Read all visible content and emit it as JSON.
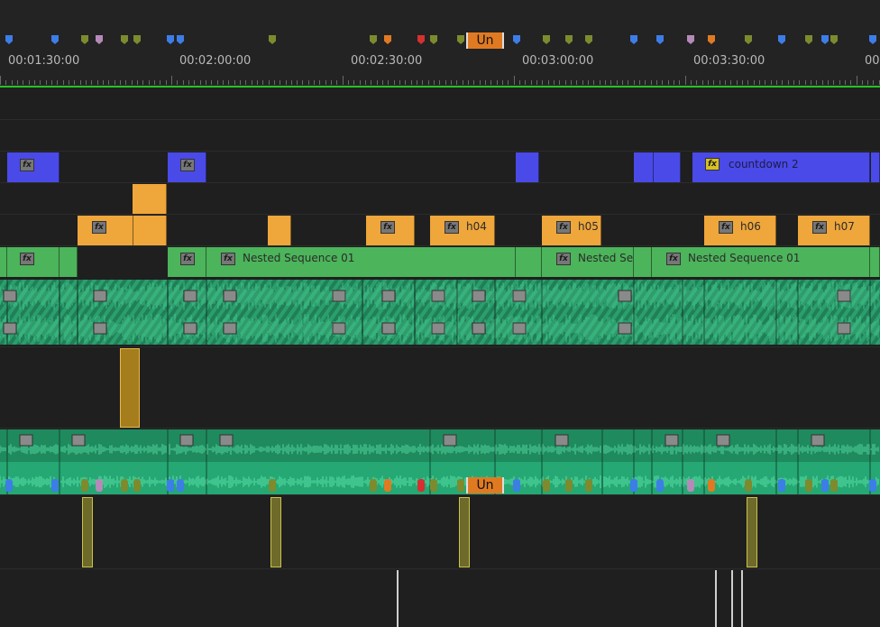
{
  "ruler": {
    "timecodes": [
      "00:01:30:00",
      "00:02:00:00",
      "00:02:30:00",
      "00:03:00:00",
      "00:03:30:00",
      "00"
    ],
    "marker_colors": {
      "blue": "#3d7de8",
      "green": "#7d8b2e",
      "pink": "#b58ab8",
      "orange": "#e07a22",
      "red": "#d63030",
      "playhead_line": "#22c422"
    },
    "markers": [
      "blue",
      "blue",
      "green",
      "pink",
      "green",
      "green",
      "blue",
      "blue",
      "green",
      "green",
      "orange",
      "red",
      "green",
      "green",
      "blue",
      "green",
      "green",
      "green",
      "blue",
      "blue",
      "pink",
      "orange",
      "green",
      "blue",
      "green",
      "blue",
      "green",
      "blue"
    ],
    "marker_label": "Un"
  },
  "tracks": {
    "v4_color": "#4a4ae8",
    "v3_color": "#efa63a",
    "v1_color": "#4cb45a",
    "audio_color": "#1fa774",
    "v4_label": "countdown 2",
    "v2_labels": [
      "h04",
      "h05",
      "h06",
      "h07"
    ],
    "v1_labels": [
      "Nested Sequence 01",
      "Nested Se",
      "Nested Sequence 01"
    ],
    "fx_label": "fx",
    "audio_marker_label": "Un"
  }
}
